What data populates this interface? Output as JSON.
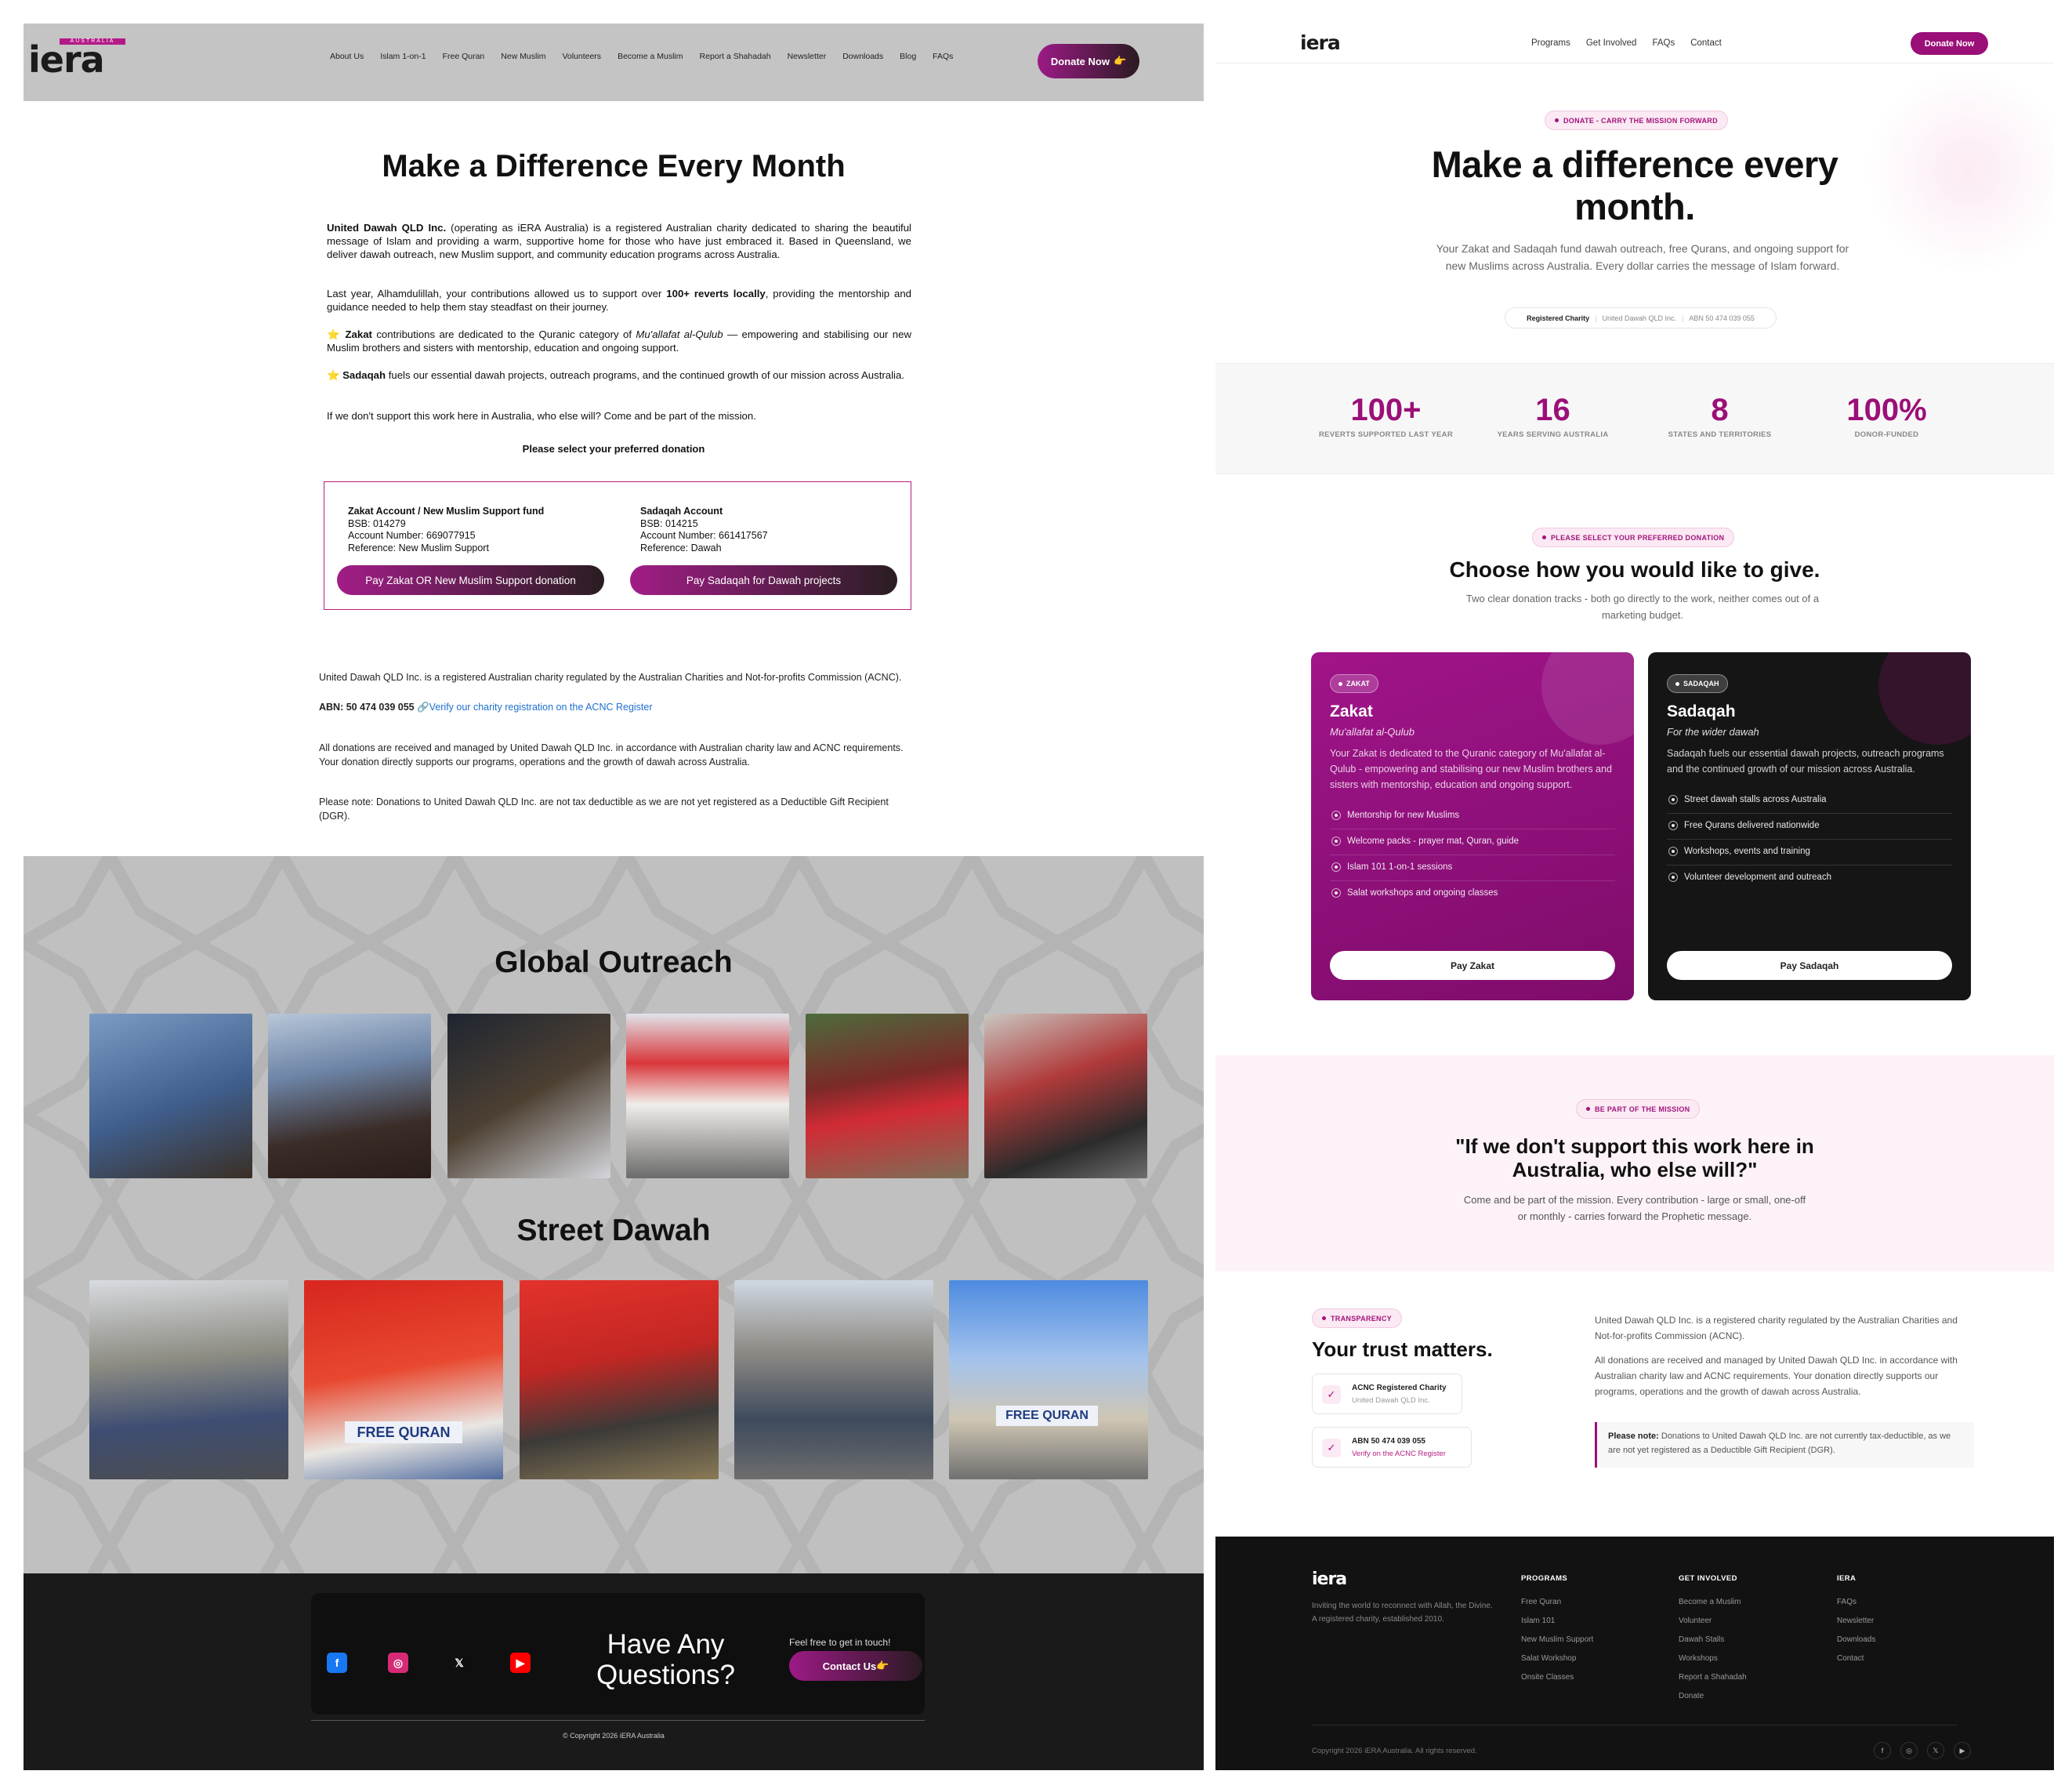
{
  "left": {
    "nav": {
      "logo_text": "iera",
      "logo_tag": "AUSTRALIA",
      "items": [
        "About Us",
        "Islam 1-on-1",
        "Free Quran",
        "New Muslim",
        "Volunteers",
        "Become a Muslim",
        "Report a Shahadah",
        "Newsletter",
        "Downloads",
        "Blog",
        "FAQs"
      ],
      "donate": "Donate Now"
    },
    "title": "Make a Difference Every Month",
    "p1_strong": "United Dawah QLD Inc.",
    "p1": " (operating as iERA Australia) is a registered Australian charity dedicated to sharing the beautiful message of Islam and providing a warm, supportive home for those who have just embraced it. Based in Queensland, we deliver dawah outreach, new Muslim support, and community education programs across Australia.",
    "p2a": "Last year, Alhamdulillah, your contributions allowed us to support over ",
    "p2_strong": "100+ reverts locally",
    "p2b": ", providing the mentorship and guidance needed to help them stay steadfast on their journey.",
    "p3_strong": "Zakat",
    "p3a": " contributions are dedicated to the Quranic category of ",
    "p3_em": "Mu'allafat al-Qulub",
    "p3b": " — empowering and stabilising our new Muslim brothers and sisters with mentorship, education and ongoing support.",
    "p4_strong": "Sadaqah",
    "p4": " fuels our essential dawah projects, outreach programs, and the continued growth of our mission across Australia.",
    "p5": "If we don't support this work here in Australia, who else will? Come and be part of the mission.",
    "select": "Please select your preferred donation",
    "zakat": {
      "title": "Zakat Account / New Muslim Support fund",
      "bsb": "BSB: 014279",
      "acc": "Account Number: 669077915",
      "ref": "Reference: New Muslim Support",
      "btn": "Pay Zakat OR New Muslim Support donation"
    },
    "sadaqah": {
      "title": "Sadaqah Account",
      "bsb": "BSB: 014215",
      "acc": "Account Number: 661417567",
      "ref": "Reference: Dawah",
      "btn": "Pay Sadaqah for Dawah projects"
    },
    "f1": "United Dawah QLD Inc. is a registered Australian charity regulated by the Australian Charities and Not-for-profits Commission (ACNC).",
    "abn": "ABN: 50 474 039 055",
    "verify": "Verify our charity registration on the ACNC Register",
    "f2": "All donations are received and managed by United Dawah QLD Inc. in accordance with Australian charity law and ACNC requirements. Your donation directly supports our programs, operations and the growth of dawah across Australia.",
    "f3": "Please note: Donations to United Dawah QLD Inc. are not tax deductible as we are not yet registered as a Deductible Gift Recipient (DGR).",
    "g1": "Global Outreach",
    "g2": "Street Dawah",
    "free_quran": "FREE QURAN",
    "questions": "Have Any Questions?",
    "feel": "Feel free to get in touch!",
    "contact": "Contact Us",
    "copyright": "© Copyright 2026 iERA Australia"
  },
  "right": {
    "nav": {
      "items": [
        "Programs",
        "Get Involved",
        "FAQs",
        "Contact"
      ],
      "donate": "Donate Now"
    },
    "pill1": "DONATE - CARRY THE MISSION FORWARD",
    "h1a": "Make a difference every",
    "h1b": "month.",
    "sub": "Your Zakat and Sadaqah fund dawah outreach, free Qurans, and ongoing support for new Muslims across Australia. Every dollar carries the message of Islam forward.",
    "reg": {
      "a": "Registered Charity",
      "b": "United Dawah QLD Inc.",
      "c": "ABN 50 474 039 055"
    },
    "stats": [
      {
        "n": "100+",
        "t": "REVERTS SUPPORTED LAST YEAR"
      },
      {
        "n": "16",
        "t": "YEARS SERVING AUSTRALIA"
      },
      {
        "n": "8",
        "t": "STATES AND TERRITORIES"
      },
      {
        "n": "100%",
        "t": "DONOR-FUNDED"
      }
    ],
    "pill2": "PLEASE SELECT YOUR PREFERRED DONATION",
    "h2": "Choose how you would like to give.",
    "sub2": "Two clear donation tracks - both go directly to the work, neither comes out of a marketing budget.",
    "zakat": {
      "tag": "ZAKAT",
      "title": "Zakat",
      "sub": "Mu'allafat al-Qulub",
      "desc": "Your Zakat is dedicated to the Quranic category of Mu'allafat al-Qulub - empowering and stabilising our new Muslim brothers and sisters with mentorship, education and ongoing support.",
      "items": [
        "Mentorship for new Muslims",
        "Welcome packs - prayer mat, Quran, guide",
        "Islam 101 1-on-1 sessions",
        "Salat workshops and ongoing classes"
      ],
      "btn": "Pay Zakat"
    },
    "sadaqah": {
      "tag": "SADAQAH",
      "title": "Sadaqah",
      "sub": "For the wider dawah",
      "desc": "Sadaqah fuels our essential dawah projects, outreach programs and the continued growth of our mission across Australia.",
      "items": [
        "Street dawah stalls across Australia",
        "Free Qurans delivered nationwide",
        "Workshops, events and training",
        "Volunteer development and outreach"
      ],
      "btn": "Pay Sadaqah"
    },
    "pill3": "BE PART OF THE MISSION",
    "q1": "\"If we don't support this work here in",
    "q2": "Australia, who else will?\"",
    "qsub": "Come and be part of the mission. Every contribution - large or small, one-off or monthly - carries forward the Prophetic message.",
    "pill4": "TRANSPARENCY",
    "trust": "Your trust matters.",
    "b1a": "ACNC Registered Charity",
    "b1b": "United Dawah QLD Inc.",
    "b2a": "ABN 50 474 039 055",
    "b2b": "Verify on the ACNC Register",
    "t1": "United Dawah QLD Inc. is a registered charity regulated by the Australian Charities and Not-for-profits Commission (ACNC).",
    "t2": "All donations are received and managed by United Dawah QLD Inc. in accordance with Australian charity law and ACNC requirements. Your donation directly supports our programs, operations and the growth of dawah across Australia.",
    "note_b": "Please note:",
    "note": " Donations to United Dawah QLD Inc. are not currently tax-deductible, as we are not yet registered as a Deductible Gift Recipient (DGR).",
    "foot": {
      "tag": "Inviting the world to reconnect with Allah, the Divine. A registered charity, established 2010.",
      "c1": {
        "h": "PROGRAMS",
        "items": [
          "Free Quran",
          "Islam 101",
          "New Muslim Support",
          "Salat Workshop",
          "Onsite Classes"
        ]
      },
      "c2": {
        "h": "GET INVOLVED",
        "items": [
          "Become a Muslim",
          "Volunteer",
          "Dawah Stalls",
          "Workshops",
          "Report a Shahadah",
          "Donate"
        ]
      },
      "c3": {
        "h": "IERA",
        "items": [
          "FAQs",
          "Newsletter",
          "Downloads",
          "Contact"
        ]
      },
      "copy": "Copyright 2026 iERA Australia. All rights reserved."
    }
  }
}
